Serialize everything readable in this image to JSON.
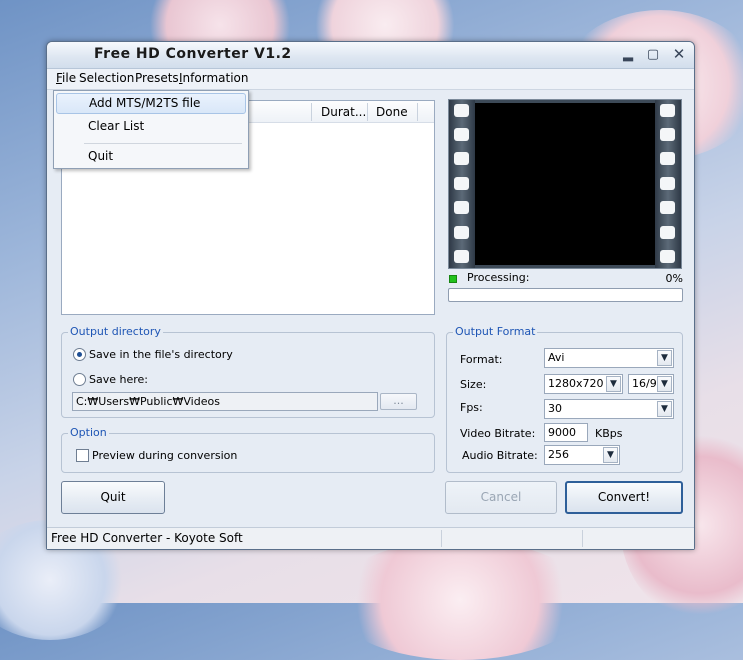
{
  "window": {
    "title": "Free HD Converter V1.2",
    "min_symbol": "▂",
    "max_symbol": "▢",
    "close_symbol": "✕"
  },
  "menu": {
    "file": "File",
    "selection": "Selection",
    "presets": "Presets",
    "information": "Information"
  },
  "file_menu": {
    "items": [
      "Add MTS/M2TS file",
      "Clear List",
      "Quit"
    ],
    "highlighted": "Add MTS/M2TS file"
  },
  "file_list": {
    "columns": [
      "Durat...",
      "Done"
    ],
    "rows": []
  },
  "processing": {
    "label": "Processing:",
    "percent_text": "0%",
    "progress": 0
  },
  "output_directory": {
    "title": "Output directory",
    "option_same": "Save in the file's directory",
    "option_here": "Save here:",
    "selected": "same",
    "path": "C:₩Users₩Public₩Videos",
    "browse_label": "..."
  },
  "option": {
    "title": "Option",
    "preview_label": "Preview during conversion",
    "preview_checked": false
  },
  "output_format": {
    "title": "Output Format",
    "format_label": "Format:",
    "format_value": "Avi",
    "size_label": "Size:",
    "size_value": "1280x720",
    "aspect_value": "16/9",
    "fps_label": "Fps:",
    "fps_value": "30",
    "video_bitrate_label": "Video Bitrate:",
    "video_bitrate_value": "9000",
    "video_bitrate_unit": "KBps",
    "audio_bitrate_label": "Audio Bitrate:",
    "audio_bitrate_value": "256"
  },
  "buttons": {
    "quit": "Quit",
    "cancel": "Cancel",
    "convert": "Convert!"
  },
  "statusbar": {
    "text": "Free HD Converter - Koyote Soft"
  },
  "colors": {
    "accent": "#1f56b5",
    "processing_led": "#22c21c"
  }
}
